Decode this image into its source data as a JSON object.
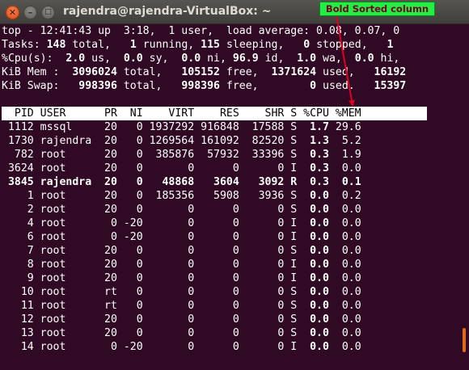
{
  "window": {
    "title": "rajendra@rajendra-VirtualBox: ~",
    "close_glyph": "✕",
    "min_glyph": "–",
    "max_glyph": "□"
  },
  "annotation": {
    "label": "Bold Sorted column",
    "color": "#22ee44",
    "arrow_color": "#e0001e"
  },
  "summary": {
    "line1": "top - 12:41:43 up  3:18,  1 user,  load average: 0.08, 0.07, 0",
    "tasks": {
      "p1": "Tasks: ",
      "v1": "148",
      "p2": " total,   ",
      "v2": "1",
      "p3": " running, ",
      "v3": "115",
      "p4": " sleeping,   ",
      "v4": "0",
      "p5": " stopped,   ",
      "v5": "1"
    },
    "cpu": {
      "p1": "%Cpu(s):  ",
      "v1": "2.0",
      "p2": " us,  ",
      "v2": "0.0",
      "p3": " sy,  ",
      "v3": "0.0",
      "p4": " ni, ",
      "v4": "96.9",
      "p5": " id,  ",
      "v5": "1.0",
      "p6": " wa,  ",
      "v6": "0.0",
      "p7": " hi,"
    },
    "mem": {
      "p1": "KiB Mem :  ",
      "v1": "3096024",
      "p2": " total,   ",
      "v2": "105152",
      "p3": " free,  ",
      "v3": "1371624",
      "p4": " used,   ",
      "v4": "16192"
    },
    "swap": {
      "p1": "KiB Swap:   ",
      "v1": "998396",
      "p2": " total,   ",
      "v2": "998396",
      "p3": " free,        ",
      "v3": "0",
      "p4": " used.   ",
      "v4": "15397"
    }
  },
  "columns_header": "  PID USER      PR  NI    VIRT    RES    SHR S %CPU %MEM",
  "processes": [
    {
      "text": " 1112 mssql     20   0 1937292 916848  17588 S  ",
      "cpu": "1.7",
      "mem": " 29.6",
      "bold": false
    },
    {
      "text": " 1730 rajendra  20   0 1269564 161092  82520 S  ",
      "cpu": "1.3",
      "mem": "  5.2",
      "bold": false
    },
    {
      "text": "  782 root      20   0  385876  57932  33396 S  ",
      "cpu": "0.3",
      "mem": "  1.9",
      "bold": false
    },
    {
      "text": " 3624 root      20   0       0      0      0 I  ",
      "cpu": "0.3",
      "mem": "  0.0",
      "bold": false
    },
    {
      "text": " 3845 rajendra  20   0   48868   3604   3092 R  ",
      "cpu": "0.3",
      "mem": "  0.1",
      "bold": true
    },
    {
      "text": "    1 root      20   0  185356   5908   3936 S  ",
      "cpu": "0.0",
      "mem": "  0.2",
      "bold": false
    },
    {
      "text": "    2 root      20   0       0      0      0 S  ",
      "cpu": "0.0",
      "mem": "  0.0",
      "bold": false
    },
    {
      "text": "    4 root       0 -20       0      0      0 I  ",
      "cpu": "0.0",
      "mem": "  0.0",
      "bold": false
    },
    {
      "text": "    6 root       0 -20       0      0      0 I  ",
      "cpu": "0.0",
      "mem": "  0.0",
      "bold": false
    },
    {
      "text": "    7 root      20   0       0      0      0 S  ",
      "cpu": "0.0",
      "mem": "  0.0",
      "bold": false
    },
    {
      "text": "    8 root      20   0       0      0      0 I  ",
      "cpu": "0.0",
      "mem": "  0.0",
      "bold": false
    },
    {
      "text": "    9 root      20   0       0      0      0 I  ",
      "cpu": "0.0",
      "mem": "  0.0",
      "bold": false
    },
    {
      "text": "   10 root      rt   0       0      0      0 S  ",
      "cpu": "0.0",
      "mem": "  0.0",
      "bold": false
    },
    {
      "text": "   11 root      rt   0       0      0      0 S  ",
      "cpu": "0.0",
      "mem": "  0.0",
      "bold": false
    },
    {
      "text": "   12 root      20   0       0      0      0 S  ",
      "cpu": "0.0",
      "mem": "  0.0",
      "bold": false
    },
    {
      "text": "   13 root      20   0       0      0      0 S  ",
      "cpu": "0.0",
      "mem": "  0.0",
      "bold": false
    },
    {
      "text": "   14 root       0 -20       0      0      0 I  ",
      "cpu": "0.0",
      "mem": "  0.0",
      "bold": false
    }
  ]
}
